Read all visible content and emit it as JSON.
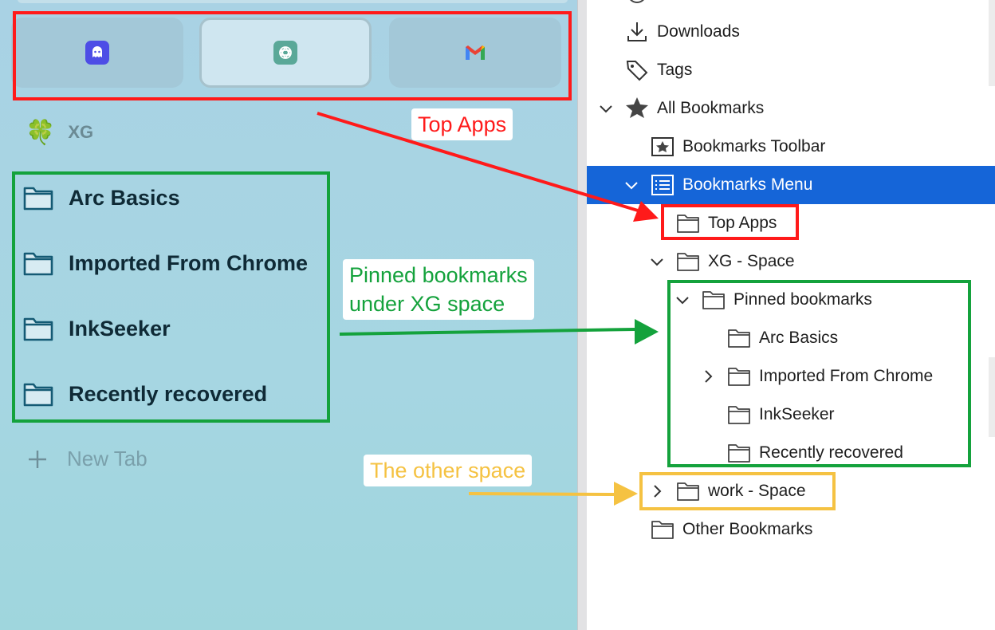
{
  "sidebar": {
    "top_apps": [
      {
        "name": "ghost-app-icon"
      },
      {
        "name": "chatgpt-icon"
      },
      {
        "name": "gmail-icon"
      }
    ],
    "space": {
      "emoji": "🍀",
      "name": "XG"
    },
    "pinned": [
      "Arc Basics",
      "Imported From Chrome",
      "InkSeeker",
      "Recently recovered"
    ],
    "new_tab_label": "New Tab"
  },
  "tree": {
    "items": [
      {
        "label": "Downloads",
        "icon": "download-icon"
      },
      {
        "label": "Tags",
        "icon": "tag-icon"
      },
      {
        "label": "All Bookmarks",
        "icon": "star-icon",
        "expanded": true
      },
      {
        "label": "Bookmarks Toolbar",
        "icon": "toolbar-star-icon"
      },
      {
        "label": "Bookmarks Menu",
        "icon": "menu-list-icon",
        "expanded": true,
        "selected": true
      },
      {
        "label": "Top Apps",
        "icon": "folder-icon"
      },
      {
        "label": "XG - Space",
        "icon": "folder-icon",
        "expanded": true
      },
      {
        "label": "Pinned bookmarks",
        "icon": "folder-icon",
        "expanded": true
      },
      {
        "label": "Arc Basics",
        "icon": "folder-icon"
      },
      {
        "label": "Imported From Chrome",
        "icon": "folder-icon",
        "expanded": false
      },
      {
        "label": "InkSeeker",
        "icon": "folder-icon"
      },
      {
        "label": "Recently recovered",
        "icon": "folder-icon"
      },
      {
        "label": "work - Space",
        "icon": "folder-icon",
        "expanded": false
      },
      {
        "label": "Other Bookmarks",
        "icon": "folder-icon"
      }
    ]
  },
  "annotations": {
    "top_apps": {
      "text": "Top Apps",
      "color": "#ff1a1a"
    },
    "pinned": {
      "line1": "Pinned bookmarks",
      "line2": "under XG space",
      "color": "#14a23c"
    },
    "other_space": {
      "text": "The other space",
      "color": "#f5c242"
    }
  }
}
